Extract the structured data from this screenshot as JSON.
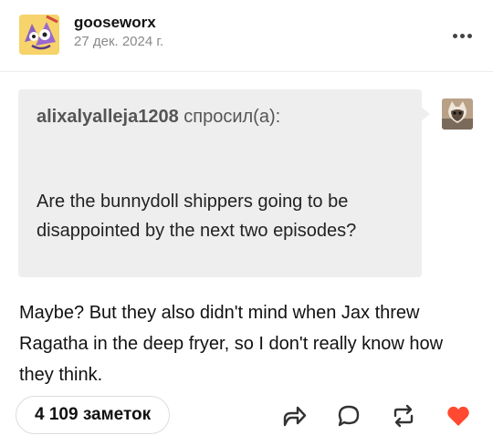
{
  "post": {
    "author": "gooseworx",
    "date": "27 дек. 2024 г."
  },
  "ask": {
    "asker": "alixalyalleja1208",
    "asked_label": "спросил(а):",
    "question": "Are the bunnydoll shippers going to be disappointed by the next two episodes?"
  },
  "answer": {
    "text": "Maybe? But they also didn't mind when Jax threw Ragatha in the deep fryer, so I don't really know how they think."
  },
  "footer": {
    "notes_label": "4 109 заметок",
    "liked_color": "#ff4930"
  },
  "icons": [
    "more-options-icon",
    "share-icon",
    "reply-icon",
    "reblog-icon",
    "like-icon"
  ]
}
